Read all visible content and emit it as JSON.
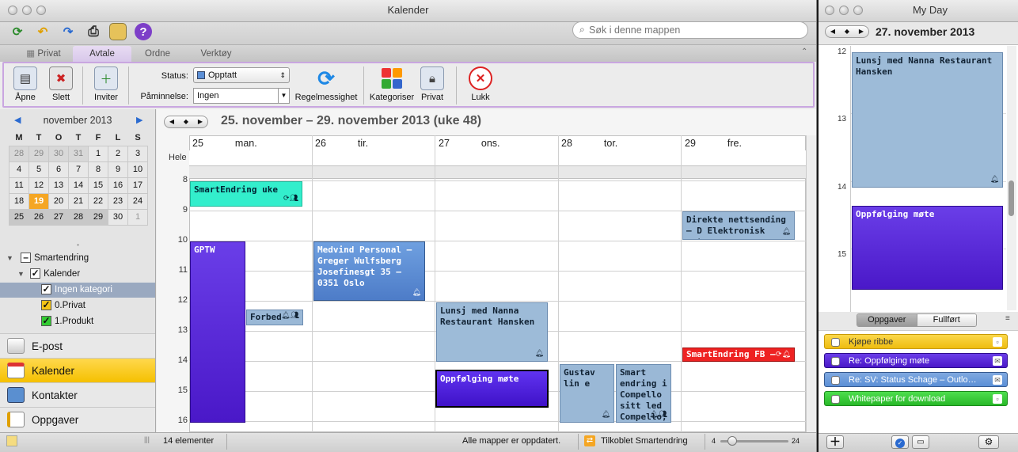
{
  "window": {
    "title": "Kalender"
  },
  "search": {
    "placeholder": "Søk i denne mappen"
  },
  "ribbon": {
    "tabs": [
      "Privat",
      "Avtale",
      "Ordne",
      "Verktøy"
    ],
    "buttons": {
      "open": "Åpne",
      "delete": "Slett",
      "invite": "Inviter",
      "recurrence": "Regelmessighet",
      "categorize": "Kategoriser",
      "private": "Privat",
      "close": "Lukk"
    },
    "status_label": "Status:",
    "status_value": "Opptatt",
    "reminder_label": "Påminnelse:",
    "reminder_value": "Ingen"
  },
  "minical": {
    "month": "november 2013",
    "weekdays": [
      "M",
      "T",
      "O",
      "T",
      "F",
      "L",
      "S"
    ],
    "weeks": [
      [
        "28",
        "29",
        "30",
        "31",
        "1",
        "2",
        "3"
      ],
      [
        "4",
        "5",
        "6",
        "7",
        "8",
        "9",
        "10"
      ],
      [
        "11",
        "12",
        "13",
        "14",
        "15",
        "16",
        "17"
      ],
      [
        "18",
        "19",
        "20",
        "21",
        "22",
        "23",
        "24"
      ],
      [
        "25",
        "26",
        "27",
        "28",
        "29",
        "30",
        "1"
      ]
    ]
  },
  "folders": {
    "root": "Smartendring",
    "calendar": "Kalender",
    "categories": [
      "Ingen kategori",
      "0.Privat",
      "1.Produkt"
    ]
  },
  "nav": [
    "E-post",
    "Kalender",
    "Kontakter",
    "Oppgaver"
  ],
  "calendar": {
    "range_title": "25. november – 29. november 2013 (uke 48)",
    "all_day_label": "Hele",
    "days": [
      {
        "num": "25",
        "name": "man."
      },
      {
        "num": "26",
        "name": "tir."
      },
      {
        "num": "27",
        "name": "ons."
      },
      {
        "num": "28",
        "name": "tor."
      },
      {
        "num": "29",
        "name": "fre."
      }
    ],
    "hours": [
      "8",
      "9",
      "10",
      "11",
      "12",
      "13",
      "14",
      "15",
      "16"
    ],
    "events": [
      {
        "id": "smartendring-uke",
        "text": "SmartEndring uke",
        "color": "#33eecc"
      },
      {
        "id": "gptw",
        "text": "GPTW",
        "color": "#5522dd"
      },
      {
        "id": "forbed",
        "text": "Forbed",
        "color": "#9ab8d6"
      },
      {
        "id": "medvind",
        "text": "Medvind Personal – Greger Wulfsberg Josefinesgt 35 – 0351 Oslo",
        "color": "#5b8fd6"
      },
      {
        "id": "lunsj",
        "text": "Lunsj med Nanna Restaurant Hansken",
        "color": "#9dbbd8"
      },
      {
        "id": "oppfolging",
        "text": "Oppfølging møte",
        "color": "#4d1fd6"
      },
      {
        "id": "direkte",
        "text": "Direkte nettsending – D Elektronisk møte",
        "color": "#9ab8d6"
      },
      {
        "id": "smartendring-fb",
        "text": "SmartEndring FB – le",
        "color": "#ee2222"
      },
      {
        "id": "gustav",
        "text": "Gustav lin e",
        "color": "#9ab8d6"
      },
      {
        "id": "smart-endring",
        "text": "Smart endring i Compello sitt led Compello, l gustav",
        "color": "#9ab8d6"
      }
    ]
  },
  "status": {
    "count": "14 elementer",
    "sync": "Alle mapper er oppdatert.",
    "connection": "Tilkoblet Smartendring",
    "zoom_min": "4",
    "zoom_max": "24",
    "zoom_level": 0.17
  },
  "myday": {
    "title": "My Day",
    "date": "27. november 2013",
    "hours": [
      "12",
      "13",
      "14",
      "15"
    ],
    "events": [
      {
        "text": "Lunsj med Nanna Restaurant Hansken"
      },
      {
        "text": "Oppfølging møte"
      }
    ],
    "tabs": [
      "Oppgaver",
      "Fullført"
    ],
    "tasks": [
      {
        "text": "Kjøpe ribbe",
        "color": "#f5c518"
      },
      {
        "text": "Re: Oppfølging møte",
        "color": "#4d1fd6"
      },
      {
        "text": "Re: SV: Status Schage – Outlo…",
        "color": "#5b8fd6"
      },
      {
        "text": "Whitepaper for download",
        "color": "#33cc33"
      }
    ]
  }
}
